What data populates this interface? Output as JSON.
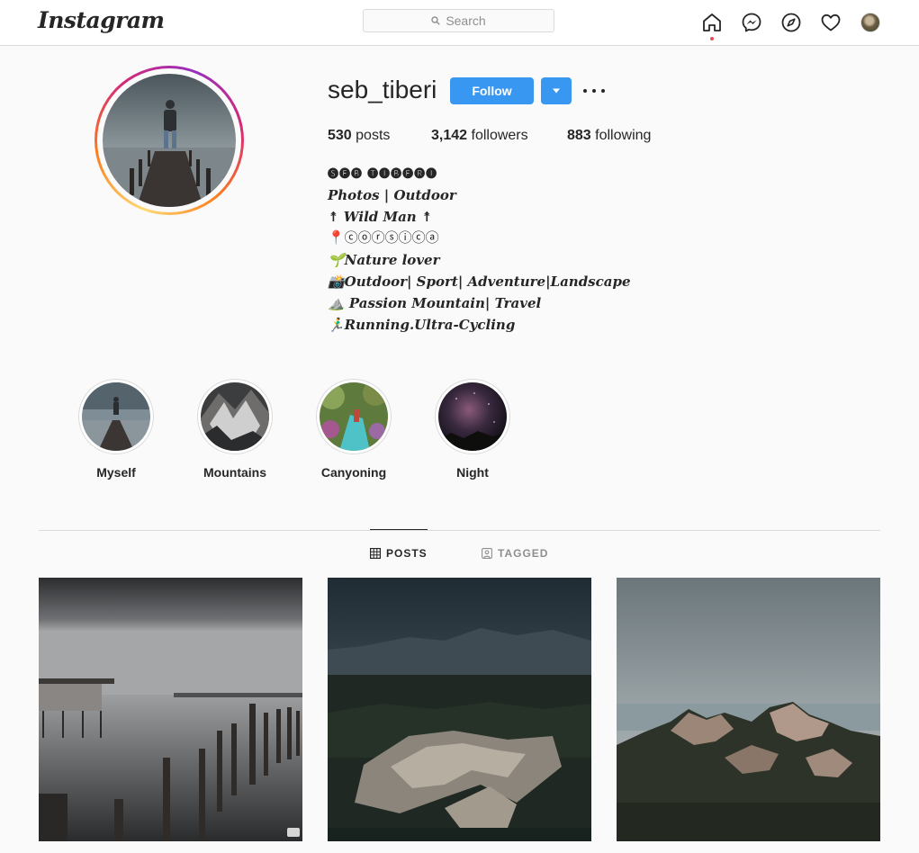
{
  "nav": {
    "logo": "Instagram",
    "search_placeholder": "Search",
    "icons": [
      "home-icon",
      "messenger-icon",
      "explore-icon",
      "heart-icon",
      "profile-avatar"
    ]
  },
  "profile": {
    "username": "seb_tiberi",
    "follow_label": "Follow",
    "stats": {
      "posts_count": "530",
      "posts_label": "posts",
      "followers_count": "3,142",
      "followers_label": "followers",
      "following_count": "883",
      "following_label": "following"
    },
    "bio": [
      "🅢🅔🅑 🅣🅘🅑🅔🅡🅘",
      "Photos | Outdoor",
      "↟ Wild Man ↟",
      "📍ⓒⓞⓡⓢⓘⓒⓐ",
      "🌱Nature lover",
      "📸Outdoor| Sport| Adventure|Landscape",
      "⛰️ Passion Mountain| Travel",
      "🏃‍♂️Running.Ultra-Cycling"
    ]
  },
  "highlights": [
    {
      "label": "Myself"
    },
    {
      "label": "Mountains"
    },
    {
      "label": "Canyoning"
    },
    {
      "label": "Night"
    }
  ],
  "tabs": {
    "posts": "POSTS",
    "tagged": "TAGGED"
  },
  "colors": {
    "accent": "#3897f0",
    "text": "#262626",
    "muted": "#8e8e8e",
    "border": "#dbdbdb",
    "notification": "#ed4956"
  }
}
